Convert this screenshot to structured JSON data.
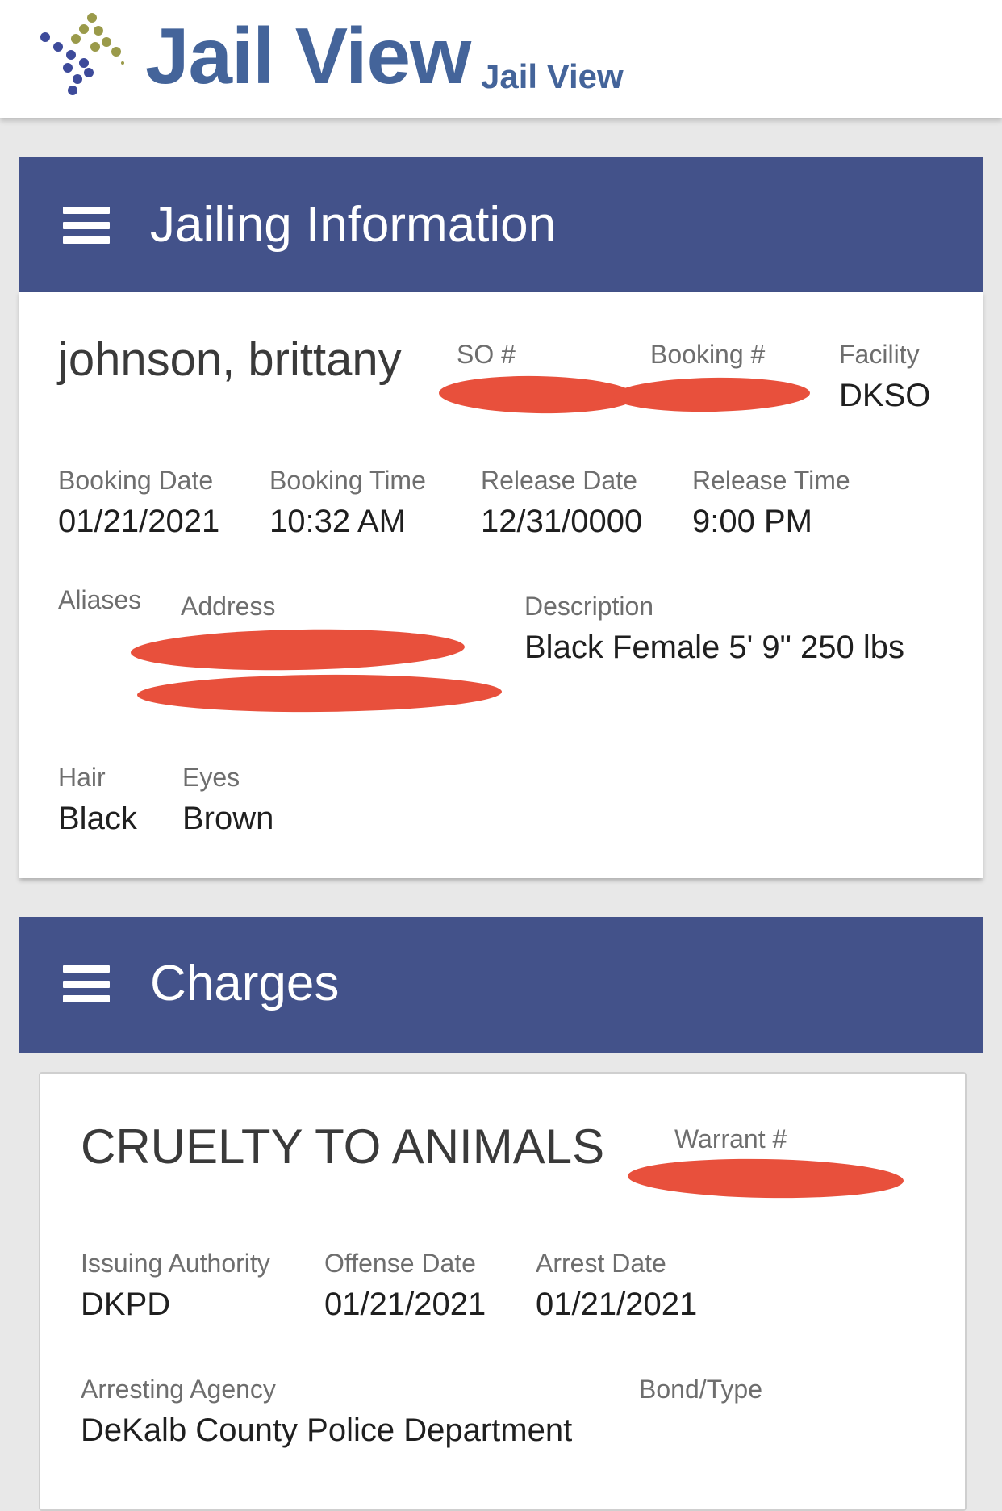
{
  "header": {
    "brand_title": "Jail View",
    "brand_subtitle": "Jail View",
    "logo_icon": "dots-cross-logo",
    "colors": {
      "brand_blue": "#44649a",
      "panel_blue": "#43528a",
      "redaction": "#e8503c"
    }
  },
  "jailing": {
    "section_title": "Jailing Information",
    "menu_icon": "hamburger-menu-icon",
    "name": "johnson, brittany",
    "so_label": "SO #",
    "booking_num_label": "Booking #",
    "facility_label": "Facility",
    "facility_value": "DKSO",
    "booking_date_label": "Booking Date",
    "booking_date_value": "01/21/2021",
    "booking_time_label": "Booking Time",
    "booking_time_value": "10:32 AM",
    "release_date_label": "Release Date",
    "release_date_value": "12/31/0000",
    "release_time_label": "Release Time",
    "release_time_value": "9:00 PM",
    "aliases_label": "Aliases",
    "address_label": "Address",
    "description_label": "Description",
    "description_value": "Black Female 5' 9\" 250 lbs",
    "hair_label": "Hair",
    "hair_value": "Black",
    "eyes_label": "Eyes",
    "eyes_value": "Brown"
  },
  "charges": {
    "section_title": "Charges",
    "menu_icon": "hamburger-menu-icon",
    "items": [
      {
        "title": "CRUELTY TO ANIMALS",
        "warrant_label": "Warrant #",
        "issuing_authority_label": "Issuing Authority",
        "issuing_authority_value": "DKPD",
        "offense_date_label": "Offense Date",
        "offense_date_value": "01/21/2021",
        "arrest_date_label": "Arrest Date",
        "arrest_date_value": "01/21/2021",
        "arresting_agency_label": "Arresting Agency",
        "arresting_agency_value": "DeKalb County Police Department",
        "bond_type_label": "Bond/Type"
      }
    ]
  }
}
